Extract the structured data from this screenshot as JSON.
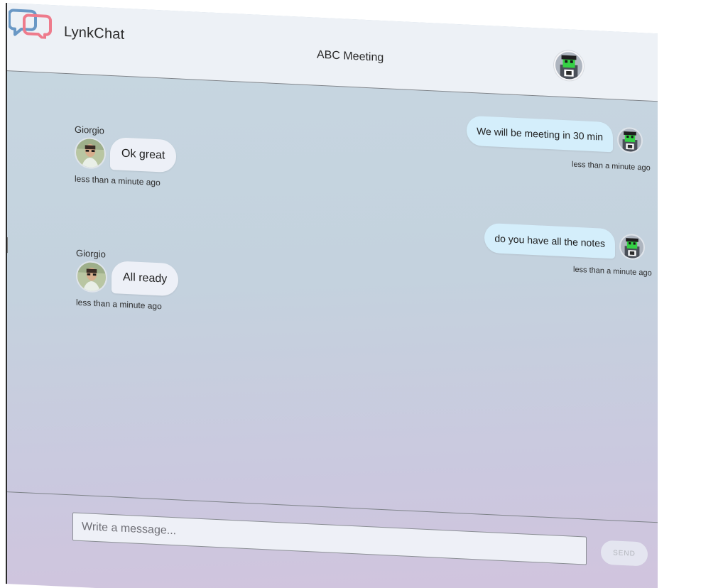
{
  "app": {
    "name": "LynkChat",
    "room_title": "ABC Meeting"
  },
  "colors": {
    "header_bg": "#edf1f6",
    "chat_gradient_top": "#c7d7e1",
    "chat_gradient_bottom": "#d2c3dd",
    "incoming_bubble": "#edf0f7",
    "outgoing_bubble": "#d4eefb",
    "logo_blue": "#6a98c5",
    "logo_pink": "#ee7b8c"
  },
  "header": {
    "current_user_avatar_icon": "pixel-avatar-icon"
  },
  "messages": [
    {
      "side": "right",
      "text": "We will be meeting in 30 min",
      "timestamp": "less than a minute ago",
      "avatar_icon": "pixel-avatar-icon"
    },
    {
      "side": "left",
      "sender": "Giorgio",
      "text": "Ok great",
      "timestamp": "less than a minute ago",
      "avatar_icon": "person-avatar-icon"
    },
    {
      "side": "right",
      "text": "do you have all the notes",
      "timestamp": "less than a minute ago",
      "avatar_icon": "pixel-avatar-icon"
    },
    {
      "side": "left",
      "sender": "Giorgio",
      "text": "All ready",
      "timestamp": "less than a minute ago",
      "avatar_icon": "person-avatar-icon"
    }
  ],
  "composer": {
    "placeholder": "Write a message...",
    "send_label": "SEND"
  }
}
